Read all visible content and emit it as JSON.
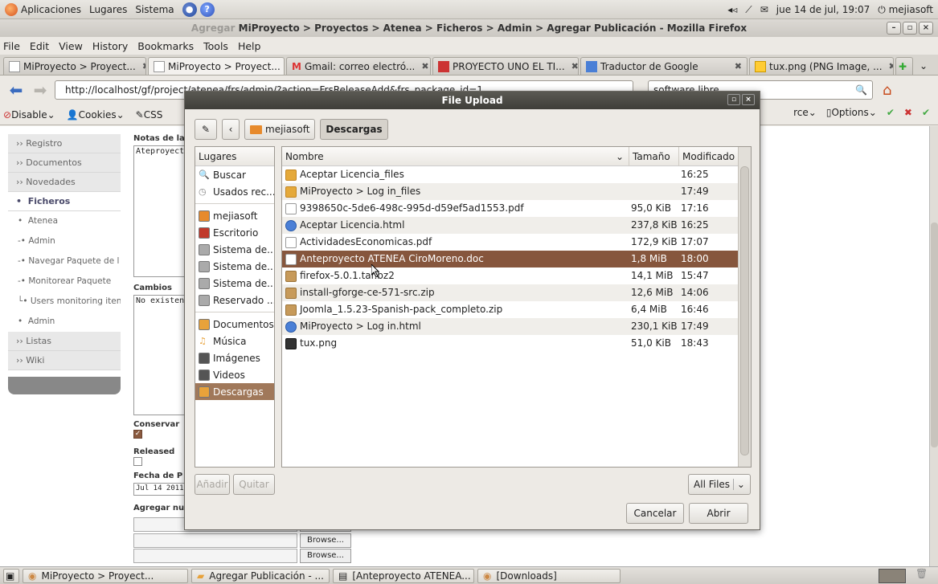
{
  "panel": {
    "apps": "Aplicaciones",
    "places": "Lugares",
    "system": "Sistema",
    "datetime": "jue 14 de jul, 19:07",
    "user": "mejiasoft"
  },
  "window": {
    "title_dim": "Agregar",
    "title": "MiProyecto > Proyectos > Atenea > Ficheros > Admin > Agregar Publicación - Mozilla Firefox"
  },
  "menu": [
    "File",
    "Edit",
    "View",
    "History",
    "Bookmarks",
    "Tools",
    "Help"
  ],
  "tabs": [
    {
      "label": "MiProyecto > Proyect...",
      "active": false
    },
    {
      "label": "MiProyecto > Proyect...",
      "active": true
    },
    {
      "label": "Gmail: correo electró...",
      "active": false
    },
    {
      "label": "PROYECTO UNO EL TI...",
      "active": false
    },
    {
      "label": "Traductor de Google",
      "active": false
    },
    {
      "label": "tux.png (PNG Image, ...",
      "active": false
    }
  ],
  "nav": {
    "url": "http://localhost/gf/project/atenea/frs/admin/?action=FrsReleaseAdd&frs_package_id=1",
    "search": "software libre"
  },
  "devbar": {
    "disable": "Disable",
    "cookies": "Cookies",
    "css": "CSS",
    "source": "rce",
    "options": "Options"
  },
  "leftnav": {
    "registro": "Registro",
    "documentos": "Documentos",
    "novedades": "Novedades",
    "ficheros": "Ficheros",
    "atenea": "Atenea",
    "admin": "Admin",
    "navegar": "Navegar Paquete de l",
    "monitorear": "Monitorear Paquete",
    "users_monitoring": "Users monitoring iten",
    "admin2": "Admin",
    "listas": "Listas",
    "wiki": "Wiki"
  },
  "form": {
    "notas_label": "Notas de la",
    "notas_value": "Ateproyect",
    "cambios_label": "Cambios",
    "cambios_value": "No existen",
    "conservar_label": "Conservar",
    "released_label": "Released",
    "fecha_label": "Fecha de P",
    "fecha_value": "Jul 14 2011",
    "agregar_label": "Agregar nu",
    "browse": "Browse..."
  },
  "dialog": {
    "title": "File Upload",
    "path_home": "mejiasoft",
    "path_current": "Descargas",
    "places_header": "Lugares",
    "places": [
      {
        "label": "Buscar",
        "icon": "search-icon",
        "color": "#555555"
      },
      {
        "label": "Usados rec...",
        "icon": "recent-icon",
        "color": "#888888"
      },
      {
        "label": "mejiasoft",
        "icon": "home-folder-icon",
        "color": "#e78a2c"
      },
      {
        "label": "Escritorio",
        "icon": "desktop-icon",
        "color": "#c0392b"
      },
      {
        "label": "Sistema de...",
        "icon": "drive-icon",
        "color": "#aaaaaa"
      },
      {
        "label": "Sistema de...",
        "icon": "drive-icon",
        "color": "#aaaaaa"
      },
      {
        "label": "Sistema de...",
        "icon": "drive-icon",
        "color": "#aaaaaa"
      },
      {
        "label": "Reservado ...",
        "icon": "drive-icon",
        "color": "#aaaaaa"
      },
      {
        "label": "Documentos",
        "icon": "documents-icon",
        "color": "#e8a23a"
      },
      {
        "label": "Música",
        "icon": "music-icon",
        "color": "#e8a23a"
      },
      {
        "label": "Imágenes",
        "icon": "images-icon",
        "color": "#555555"
      },
      {
        "label": "Videos",
        "icon": "videos-icon",
        "color": "#555555"
      },
      {
        "label": "Descargas",
        "icon": "downloads-icon",
        "color": "#e8a23a"
      }
    ],
    "columns": {
      "name": "Nombre",
      "size": "Tamaño",
      "modified": "Modificado"
    },
    "files": [
      {
        "name": "Aceptar Licencia_files",
        "size": "",
        "modified": "16:25",
        "icon": "folder-icon"
      },
      {
        "name": "MiProyecto > Log in_files",
        "size": "",
        "modified": "17:49",
        "icon": "folder-icon"
      },
      {
        "name": "9398650c-5de6-498c-995d-d59ef5ad1553.pdf",
        "size": "95,0 KiB",
        "modified": "17:16",
        "icon": "pdf-icon"
      },
      {
        "name": "Aceptar Licencia.html",
        "size": "237,8 KiB",
        "modified": "16:25",
        "icon": "html-icon"
      },
      {
        "name": "ActividadesEconomicas.pdf",
        "size": "172,9 KiB",
        "modified": "17:07",
        "icon": "pdf-icon"
      },
      {
        "name": "Anteproyecto ATENEA CiroMoreno.doc",
        "size": "1,8 MiB",
        "modified": "18:00",
        "icon": "doc-icon",
        "selected": true
      },
      {
        "name": "firefox-5.0.1.tar.bz2",
        "size": "14,1 MiB",
        "modified": "15:47",
        "icon": "archive-icon"
      },
      {
        "name": "install-gforge-ce-571-src.zip",
        "size": "12,6 MiB",
        "modified": "14:06",
        "icon": "archive-icon"
      },
      {
        "name": "Joomla_1.5.23-Spanish-pack_completo.zip",
        "size": "6,4 MiB",
        "modified": "16:46",
        "icon": "archive-icon"
      },
      {
        "name": "MiProyecto > Log in.html",
        "size": "230,1 KiB",
        "modified": "17:49",
        "icon": "html-icon"
      },
      {
        "name": "tux.png",
        "size": "51,0 KiB",
        "modified": "18:43",
        "icon": "image-icon"
      }
    ],
    "add": "Añadir",
    "remove": "Quitar",
    "filter": "All Files",
    "cancel": "Cancelar",
    "open": "Abrir"
  },
  "taskbar": [
    {
      "label": "MiProyecto > Proyect..."
    },
    {
      "label": "Agregar Publicación - ..."
    },
    {
      "label": "[Anteproyecto ATENEA..."
    },
    {
      "label": "[Downloads]"
    }
  ],
  "colors": {
    "selection": "#86563d",
    "places_selection": "#a0785a",
    "dialog_title": "#3f3e39"
  }
}
